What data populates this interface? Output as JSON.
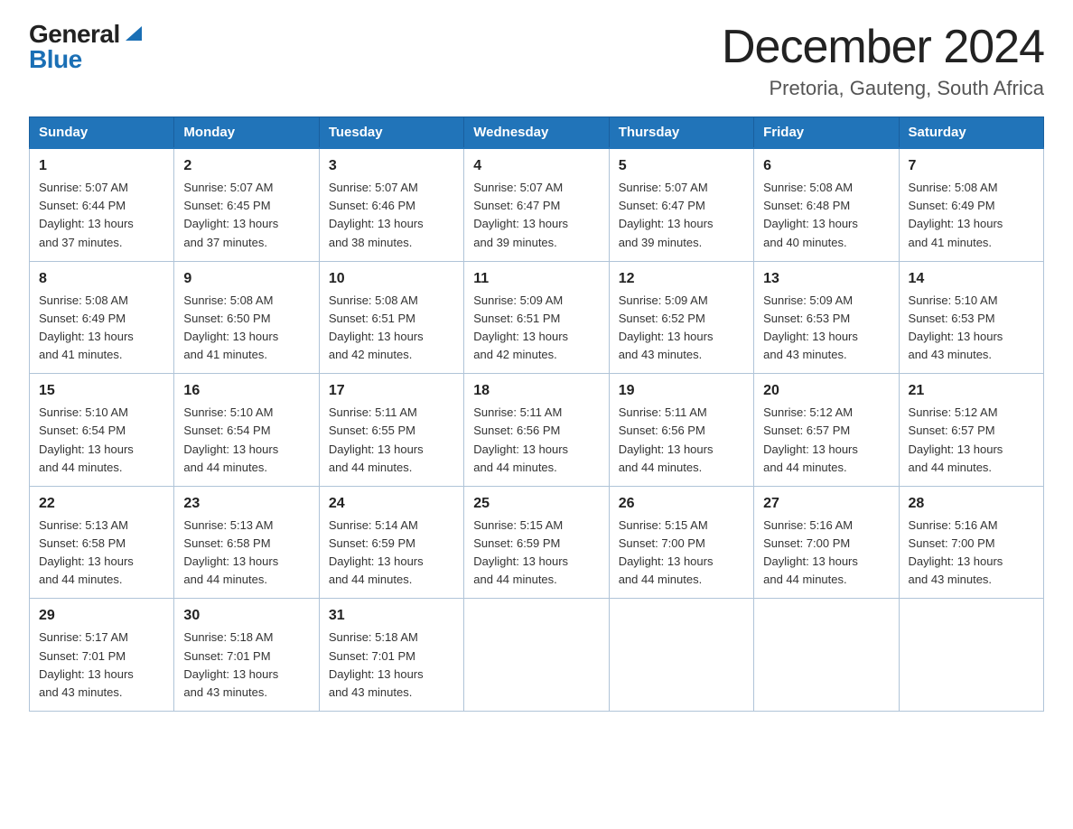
{
  "header": {
    "logo_general": "General",
    "logo_blue": "Blue",
    "month_title": "December 2024",
    "location": "Pretoria, Gauteng, South Africa"
  },
  "days_of_week": [
    "Sunday",
    "Monday",
    "Tuesday",
    "Wednesday",
    "Thursday",
    "Friday",
    "Saturday"
  ],
  "weeks": [
    [
      {
        "day": "1",
        "info": "Sunrise: 5:07 AM\nSunset: 6:44 PM\nDaylight: 13 hours\nand 37 minutes."
      },
      {
        "day": "2",
        "info": "Sunrise: 5:07 AM\nSunset: 6:45 PM\nDaylight: 13 hours\nand 37 minutes."
      },
      {
        "day": "3",
        "info": "Sunrise: 5:07 AM\nSunset: 6:46 PM\nDaylight: 13 hours\nand 38 minutes."
      },
      {
        "day": "4",
        "info": "Sunrise: 5:07 AM\nSunset: 6:47 PM\nDaylight: 13 hours\nand 39 minutes."
      },
      {
        "day": "5",
        "info": "Sunrise: 5:07 AM\nSunset: 6:47 PM\nDaylight: 13 hours\nand 39 minutes."
      },
      {
        "day": "6",
        "info": "Sunrise: 5:08 AM\nSunset: 6:48 PM\nDaylight: 13 hours\nand 40 minutes."
      },
      {
        "day": "7",
        "info": "Sunrise: 5:08 AM\nSunset: 6:49 PM\nDaylight: 13 hours\nand 41 minutes."
      }
    ],
    [
      {
        "day": "8",
        "info": "Sunrise: 5:08 AM\nSunset: 6:49 PM\nDaylight: 13 hours\nand 41 minutes."
      },
      {
        "day": "9",
        "info": "Sunrise: 5:08 AM\nSunset: 6:50 PM\nDaylight: 13 hours\nand 41 minutes."
      },
      {
        "day": "10",
        "info": "Sunrise: 5:08 AM\nSunset: 6:51 PM\nDaylight: 13 hours\nand 42 minutes."
      },
      {
        "day": "11",
        "info": "Sunrise: 5:09 AM\nSunset: 6:51 PM\nDaylight: 13 hours\nand 42 minutes."
      },
      {
        "day": "12",
        "info": "Sunrise: 5:09 AM\nSunset: 6:52 PM\nDaylight: 13 hours\nand 43 minutes."
      },
      {
        "day": "13",
        "info": "Sunrise: 5:09 AM\nSunset: 6:53 PM\nDaylight: 13 hours\nand 43 minutes."
      },
      {
        "day": "14",
        "info": "Sunrise: 5:10 AM\nSunset: 6:53 PM\nDaylight: 13 hours\nand 43 minutes."
      }
    ],
    [
      {
        "day": "15",
        "info": "Sunrise: 5:10 AM\nSunset: 6:54 PM\nDaylight: 13 hours\nand 44 minutes."
      },
      {
        "day": "16",
        "info": "Sunrise: 5:10 AM\nSunset: 6:54 PM\nDaylight: 13 hours\nand 44 minutes."
      },
      {
        "day": "17",
        "info": "Sunrise: 5:11 AM\nSunset: 6:55 PM\nDaylight: 13 hours\nand 44 minutes."
      },
      {
        "day": "18",
        "info": "Sunrise: 5:11 AM\nSunset: 6:56 PM\nDaylight: 13 hours\nand 44 minutes."
      },
      {
        "day": "19",
        "info": "Sunrise: 5:11 AM\nSunset: 6:56 PM\nDaylight: 13 hours\nand 44 minutes."
      },
      {
        "day": "20",
        "info": "Sunrise: 5:12 AM\nSunset: 6:57 PM\nDaylight: 13 hours\nand 44 minutes."
      },
      {
        "day": "21",
        "info": "Sunrise: 5:12 AM\nSunset: 6:57 PM\nDaylight: 13 hours\nand 44 minutes."
      }
    ],
    [
      {
        "day": "22",
        "info": "Sunrise: 5:13 AM\nSunset: 6:58 PM\nDaylight: 13 hours\nand 44 minutes."
      },
      {
        "day": "23",
        "info": "Sunrise: 5:13 AM\nSunset: 6:58 PM\nDaylight: 13 hours\nand 44 minutes."
      },
      {
        "day": "24",
        "info": "Sunrise: 5:14 AM\nSunset: 6:59 PM\nDaylight: 13 hours\nand 44 minutes."
      },
      {
        "day": "25",
        "info": "Sunrise: 5:15 AM\nSunset: 6:59 PM\nDaylight: 13 hours\nand 44 minutes."
      },
      {
        "day": "26",
        "info": "Sunrise: 5:15 AM\nSunset: 7:00 PM\nDaylight: 13 hours\nand 44 minutes."
      },
      {
        "day": "27",
        "info": "Sunrise: 5:16 AM\nSunset: 7:00 PM\nDaylight: 13 hours\nand 44 minutes."
      },
      {
        "day": "28",
        "info": "Sunrise: 5:16 AM\nSunset: 7:00 PM\nDaylight: 13 hours\nand 43 minutes."
      }
    ],
    [
      {
        "day": "29",
        "info": "Sunrise: 5:17 AM\nSunset: 7:01 PM\nDaylight: 13 hours\nand 43 minutes."
      },
      {
        "day": "30",
        "info": "Sunrise: 5:18 AM\nSunset: 7:01 PM\nDaylight: 13 hours\nand 43 minutes."
      },
      {
        "day": "31",
        "info": "Sunrise: 5:18 AM\nSunset: 7:01 PM\nDaylight: 13 hours\nand 43 minutes."
      },
      {
        "day": "",
        "info": ""
      },
      {
        "day": "",
        "info": ""
      },
      {
        "day": "",
        "info": ""
      },
      {
        "day": "",
        "info": ""
      }
    ]
  ]
}
